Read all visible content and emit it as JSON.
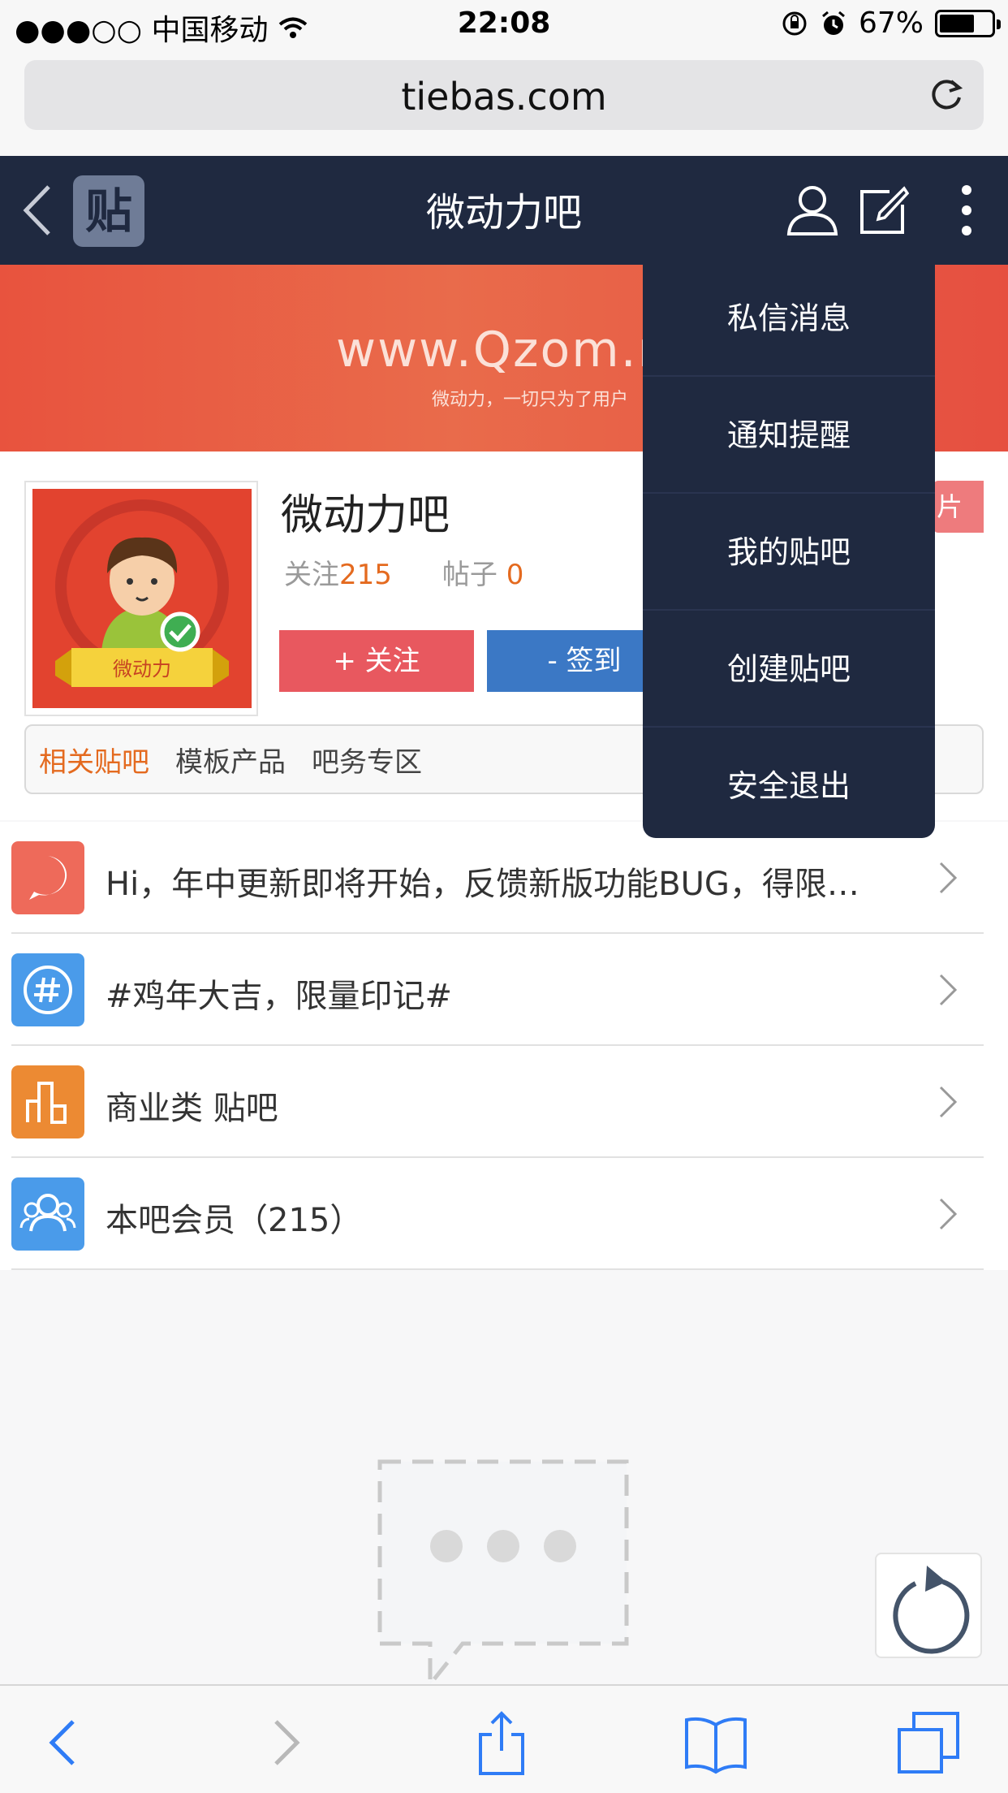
{
  "status_bar": {
    "carrier": "●●●○○ 中国移动",
    "time": "22:08",
    "battery": "67%",
    "battery_level": 0.67
  },
  "browser": {
    "url": "tiebas.com"
  },
  "header": {
    "logo_text": "贴",
    "title": "微动力吧"
  },
  "banner": {
    "site": "www.Qzom.n",
    "slogan": "微动力，一切只为了用户"
  },
  "forum": {
    "name": "微动力吧",
    "avatar_ribbon": "微动力",
    "follow_label": "关注",
    "follow_count": "215",
    "posts_label": "帖子",
    "posts_count": "0",
    "follow_button": "+ 关注",
    "signin_button": "- 签到",
    "pic_badge": "图片"
  },
  "tabs": [
    "相关贴吧",
    "模板产品",
    "吧务专区"
  ],
  "list": [
    {
      "icon": "announcement-icon",
      "color": "#ee6a5a",
      "label": "Hi，年中更新即将开始，反馈新版功能BUG，得限…"
    },
    {
      "icon": "hashtag-icon",
      "color": "#4a9bea",
      "label": "#鸡年大吉，限量印记#"
    },
    {
      "icon": "bar-chart-icon",
      "color": "#ec8a33",
      "label": "商业类 贴吧"
    },
    {
      "icon": "members-icon",
      "color": "#4a9bea",
      "label": "本吧会员（215）"
    }
  ],
  "menu": [
    "私信消息",
    "通知提醒",
    "我的贴吧",
    "创建贴吧",
    "安全退出"
  ],
  "colors": {
    "header_bg": "#1f2940",
    "accent_orange": "#e46a1f",
    "follow_red": "#e8585f",
    "signin_blue": "#3b78c5"
  }
}
